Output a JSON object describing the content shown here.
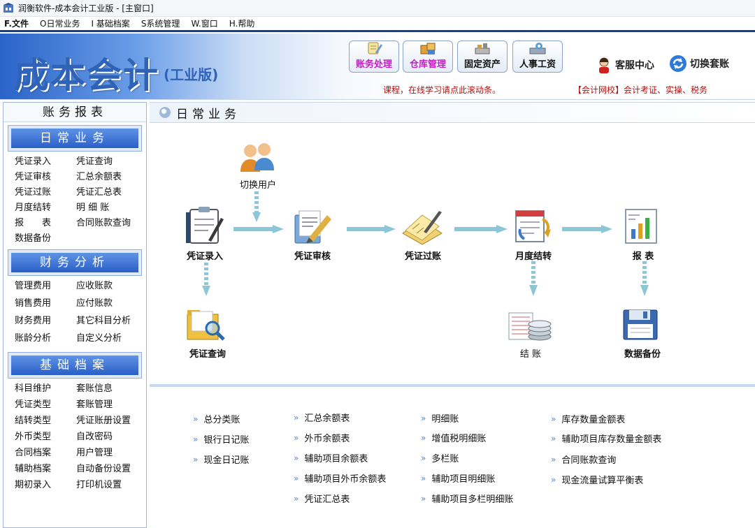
{
  "window": {
    "title": "润衡软件-成本会计工业版 - [主窗口]"
  },
  "menu": [
    "F.文件",
    "O日常业务",
    "I 基础档案",
    "S系统管理",
    "W.窗口",
    "H.帮助"
  ],
  "banner": {
    "app_title": "成本会计",
    "edition": "(工业版)",
    "modules": {
      "accounts": "账务处理",
      "warehouse": "仓库管理",
      "assets": "固定资产",
      "payroll": "人事工资"
    },
    "service": "客服中心",
    "switch_book": "切换套账",
    "marquee_left": "课程，在线学习请点此滚动条。",
    "marquee_right": "【会计网校】会计考证、实操、税务"
  },
  "sidebar": {
    "title": "账务报表",
    "sections": [
      {
        "title": "日常业务",
        "items": [
          "凭证录入",
          "凭证查询",
          "凭证审核",
          "汇总余额表",
          "凭证过账",
          "凭证汇总表",
          "月度结转",
          "明 细 账",
          "报　　表",
          "合同账款查询",
          "数据备份"
        ]
      },
      {
        "title": "财务分析",
        "items": [
          "管理费用",
          "应收账款",
          "销售费用",
          "应付账款",
          "财务费用",
          "其它科目分析",
          "账龄分析",
          "自定义分析"
        ]
      },
      {
        "title": "基础档案",
        "items": [
          "科目维护",
          "套账信息",
          "凭证类型",
          "套账管理",
          "结转类型",
          "凭证账册设置",
          "外币类型",
          "自改密码",
          "合同档案",
          "用户管理",
          "辅助档案",
          "自动备份设置",
          "期初录入",
          "打印机设置"
        ]
      }
    ]
  },
  "main": {
    "header": "日常业务",
    "workflow": {
      "switch_user": "切换用户",
      "voucher_entry": "凭证录入",
      "voucher_audit": "凭证审核",
      "voucher_posting": "凭证过账",
      "month_end": "月度结转",
      "reports": "报  表",
      "voucher_query": "凭证查询",
      "closing": "结  账",
      "backup": "数据备份"
    },
    "report_links": [
      [
        "总分类账",
        "银行日记账",
        "现金日记账"
      ],
      [
        "汇总余额表",
        "外币余额表",
        "辅助项目余额表",
        "辅助项目外币余额表",
        "凭证汇总表"
      ],
      [
        "明细账",
        "增值税明细账",
        "多栏账",
        "辅助项目明细账",
        "辅助项目多栏明细账"
      ],
      [
        "库存数量金额表",
        "辅助项目库存数量金额表",
        "合同账款查询",
        "现金流量试算平衡表"
      ]
    ]
  }
}
